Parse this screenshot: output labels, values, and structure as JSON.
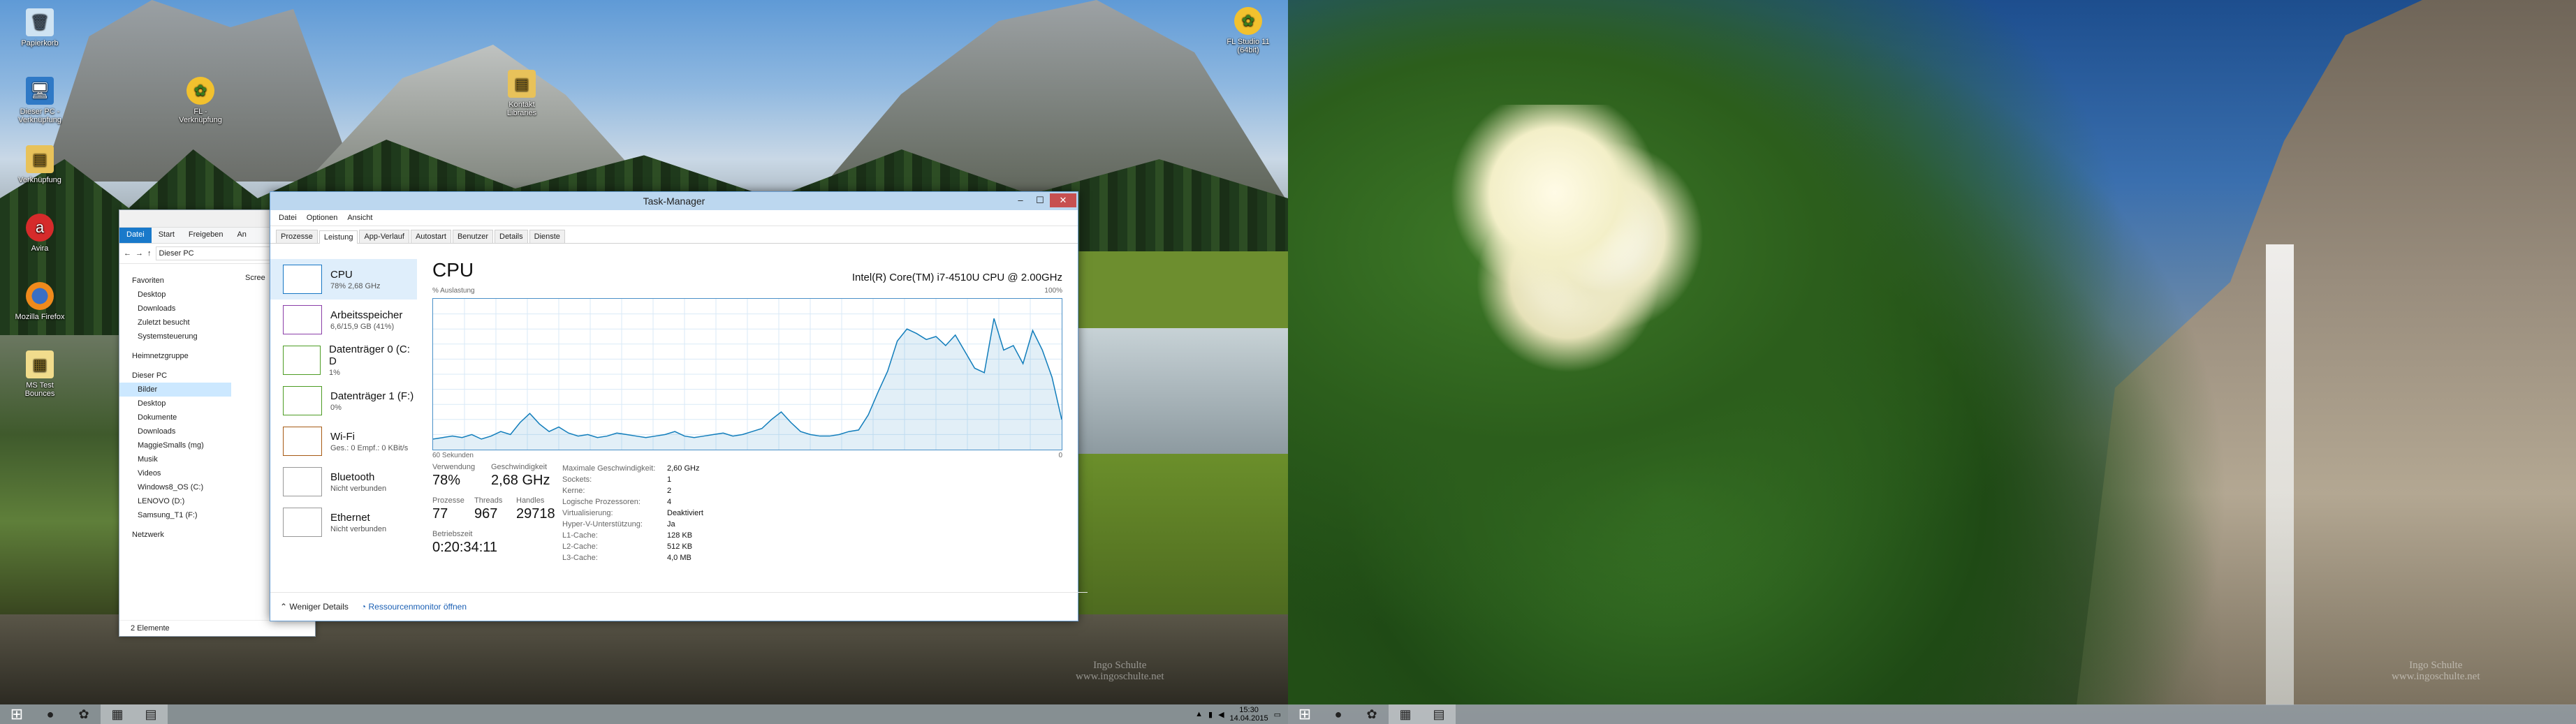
{
  "desktop_icons": [
    {
      "label": "Papierkorb",
      "icon": "recycle-bin-icon"
    },
    {
      "label": "Dieser PC - Verknüpfung",
      "icon": "computer-icon"
    },
    {
      "label": "FL - Verknüpfung",
      "icon": "fl-studio-icon"
    },
    {
      "label": "Kontakt Libraries",
      "icon": "folder-icon"
    },
    {
      "label": "Verknüpfung",
      "icon": "folder-icon"
    },
    {
      "label": "Avira",
      "icon": "avira-icon"
    },
    {
      "label": "Mozilla Firefox",
      "icon": "firefox-icon"
    },
    {
      "label": "MS Test Bounces",
      "icon": "document-icon"
    },
    {
      "label": "FL Studio 11 (64bit)",
      "icon": "fl-studio-icon"
    }
  ],
  "explorer": {
    "ribbon_tabs": [
      "Datei",
      "Start",
      "Freigeben",
      "An"
    ],
    "address": "Dieser PC",
    "content_label": "Scree",
    "nav": {
      "favorites": "Favoriten",
      "fav_items": [
        "Desktop",
        "Downloads",
        "Zuletzt besucht",
        "Systemsteuerung"
      ],
      "homegroup": "Heimnetzgruppe",
      "this_pc": "Dieser PC",
      "pc_items": [
        "Bilder",
        "Desktop",
        "Dokumente",
        "Downloads",
        "MaggieSmalls (mg)",
        "Musik",
        "Videos",
        "Windows8_OS (C:)",
        "LENOVO (D:)",
        "Samsung_T1 (F:)"
      ],
      "network": "Netzwerk"
    },
    "status": "2 Elemente"
  },
  "taskmanager": {
    "title": "Task-Manager",
    "menu": [
      "Datei",
      "Optionen",
      "Ansicht"
    ],
    "tabs": [
      "Prozesse",
      "Leistung",
      "App-Verlauf",
      "Autostart",
      "Benutzer",
      "Details",
      "Dienste"
    ],
    "active_tab": "Leistung",
    "resources": [
      {
        "title": "CPU",
        "sub": "78% 2,68 GHz",
        "color": "#1777c4"
      },
      {
        "title": "Arbeitsspeicher",
        "sub": "6,6/15,9 GB (41%)",
        "color": "#8b3fa8"
      },
      {
        "title": "Datenträger 0 (C: D",
        "sub": "1%",
        "color": "#4d9c24"
      },
      {
        "title": "Datenträger 1 (F:)",
        "sub": "0%",
        "color": "#4d9c24"
      },
      {
        "title": "Wi-Fi",
        "sub": "Ges.: 0 Empf.: 0 KBit/s",
        "color": "#a75a14"
      },
      {
        "title": "Bluetooth",
        "sub": "Nicht verbunden",
        "color": "#999999"
      },
      {
        "title": "Ethernet",
        "sub": "Nicht verbunden",
        "color": "#999999"
      }
    ],
    "cpu": {
      "title": "CPU",
      "model": "Intel(R) Core(TM) i7-4510U CPU @ 2.00GHz",
      "y_label": "% Auslastung",
      "y_max": "100%",
      "x_label": "60 Sekunden",
      "x_min": "0",
      "stats": {
        "usage_label": "Verwendung",
        "usage": "78%",
        "speed_label": "Geschwindigkeit",
        "speed": "2,68 GHz",
        "processes_label": "Prozesse",
        "processes": "77",
        "threads_label": "Threads",
        "threads": "967",
        "handles_label": "Handles",
        "handles": "29718",
        "uptime_label": "Betriebszeit",
        "uptime": "0:20:34:11"
      },
      "details": [
        {
          "k": "Maximale Geschwindigkeit:",
          "v": "2,60 GHz"
        },
        {
          "k": "Sockets:",
          "v": "1"
        },
        {
          "k": "Kerne:",
          "v": "2"
        },
        {
          "k": "Logische Prozessoren:",
          "v": "4"
        },
        {
          "k": "Virtualisierung:",
          "v": "Deaktiviert"
        },
        {
          "k": "Hyper-V-Unterstützung:",
          "v": "Ja"
        },
        {
          "k": "L1-Cache:",
          "v": "128 KB"
        },
        {
          "k": "L2-Cache:",
          "v": "512 KB"
        },
        {
          "k": "L3-Cache:",
          "v": "4,0 MB"
        }
      ]
    },
    "footer": {
      "fewer": "Weniger Details",
      "monitor": "Ressourcenmonitor öffnen"
    }
  },
  "chart_data": {
    "type": "area",
    "y_range": [
      0,
      100
    ],
    "x_range_seconds": [
      60,
      0
    ],
    "values": [
      7,
      8,
      9,
      8,
      10,
      7,
      9,
      12,
      10,
      18,
      24,
      17,
      12,
      15,
      11,
      9,
      10,
      8,
      9,
      11,
      10,
      9,
      8,
      9,
      10,
      12,
      9,
      8,
      9,
      10,
      11,
      9,
      10,
      12,
      14,
      20,
      25,
      18,
      12,
      10,
      9,
      9,
      10,
      12,
      13,
      23,
      38,
      52,
      72,
      80,
      77,
      73,
      75,
      69,
      76,
      65,
      54,
      51,
      87,
      66,
      69,
      57,
      79,
      66,
      48,
      20
    ]
  },
  "watermark": {
    "left": "Ingo Schulte\nwww.ingoschulte.net",
    "right": "Ingo Schulte\nwww.ingoschulte.net"
  },
  "taskbar": {
    "time": "15:30",
    "date": "14.04.2015"
  }
}
